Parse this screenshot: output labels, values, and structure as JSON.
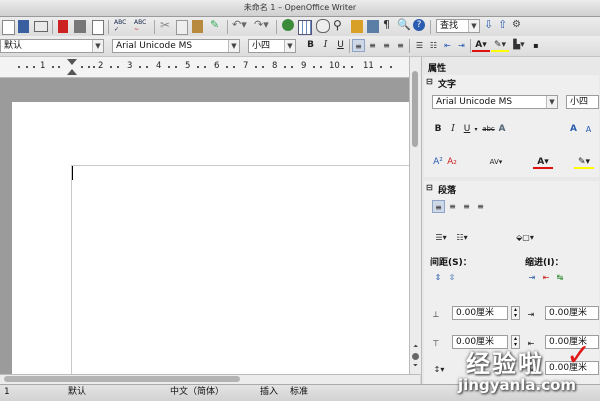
{
  "window": {
    "title": "未命名 1 – OpenOffice Writer"
  },
  "toolbar": {
    "find_placeholder": "查找",
    "style": "默认",
    "font": "Arial Unicode MS",
    "size": "小四",
    "bold": "B",
    "italic": "I",
    "underline": "U"
  },
  "ruler": {
    "numbers": [
      "1",
      "2",
      "3",
      "4",
      "5",
      "6",
      "7",
      "8",
      "9",
      "10",
      "11"
    ]
  },
  "sidebar": {
    "title": "属性",
    "text_section": {
      "title": "文字",
      "font": "Arial Unicode MS",
      "size": "小四",
      "bold": "B",
      "italic": "I",
      "underline": "U"
    },
    "paragraph_section": {
      "title": "段落",
      "spacing_label": "间距(S)：",
      "indent_label": "缩进(I)：",
      "above_value": "0.00厘米",
      "before_indent_value": "0.00厘米",
      "below_value": "0.00厘米",
      "after_indent_value": "0.00厘米",
      "first_indent_value": "0.00厘米"
    }
  },
  "statusbar": {
    "page": "1",
    "style": "默认",
    "language": "中文（简体）",
    "mode": "插入",
    "selection": "标准"
  },
  "watermark": {
    "brand": "经验啦",
    "site": "jingyanla.com"
  }
}
